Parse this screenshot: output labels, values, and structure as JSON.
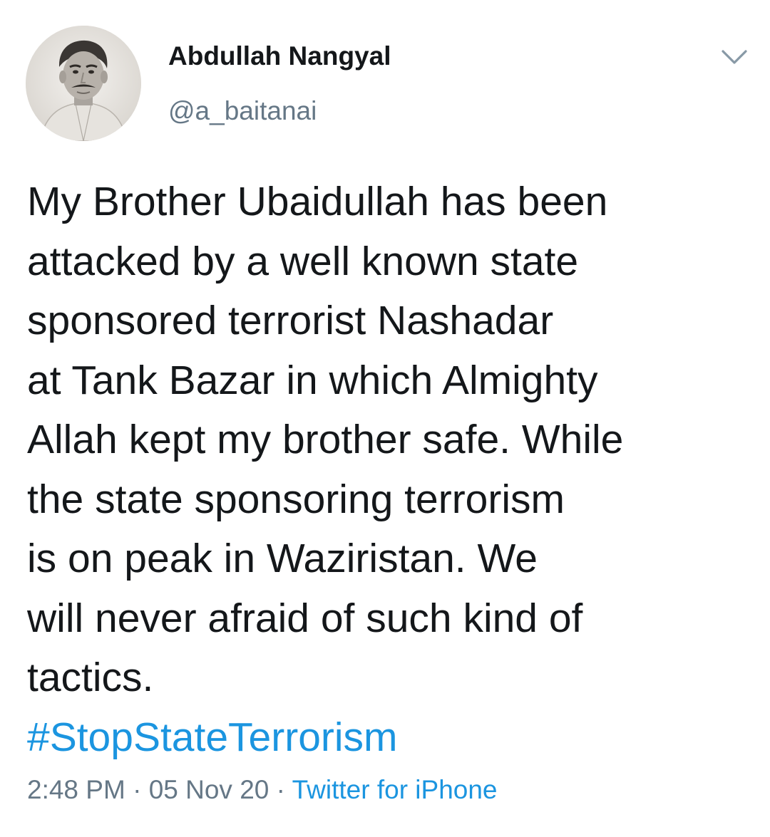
{
  "tweet": {
    "author": {
      "display_name": "Abdullah Nangyal",
      "handle": "@a_baitanai",
      "avatar_icon": "profile-photo"
    },
    "menu_icon": "chevron-down-icon",
    "text_lines": [
      "My Brother Ubaidullah has been",
      "attacked by a well known state",
      "sponsored terrorist Nashadar",
      "at Tank Bazar in which Almighty",
      "Allah kept my brother safe. While",
      "the state sponsoring terrorism",
      "is on peak in Waziristan. We",
      "will never afraid of such kind of",
      "tactics."
    ],
    "hashtag": "#StopStateTerrorism",
    "time": "2:48 PM",
    "separator": "·",
    "date": "05 Nov 20",
    "source": "Twitter for iPhone"
  },
  "colors": {
    "text": "#14171a",
    "secondary": "#657786",
    "link": "#1b95e0",
    "background": "#ffffff"
  }
}
